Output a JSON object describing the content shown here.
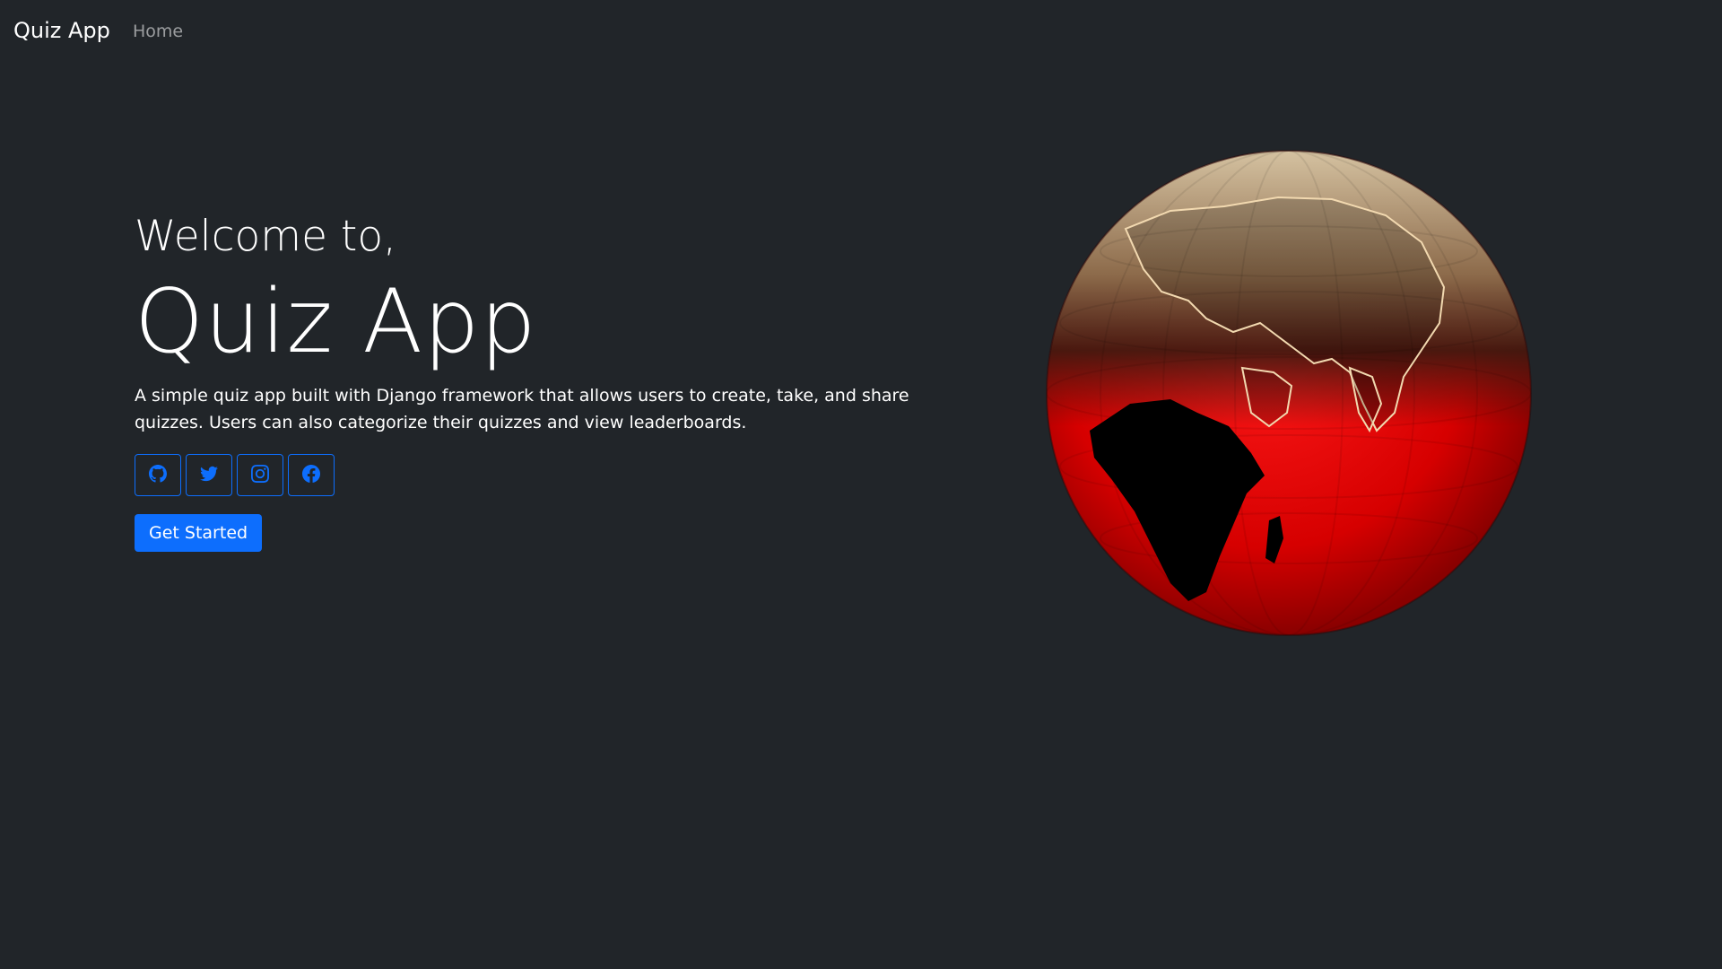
{
  "navbar": {
    "brand": "Quiz App",
    "links": [
      {
        "label": "Home"
      }
    ]
  },
  "hero": {
    "welcome": "Welcome to,",
    "title": "Quiz App",
    "description": "A simple quiz app built with Django framework that allows users to create, take, and share quizzes. Users can also categorize their quizzes and view leaderboards.",
    "social": [
      {
        "icon": "github-icon"
      },
      {
        "icon": "twitter-icon"
      },
      {
        "icon": "instagram-icon"
      },
      {
        "icon": "facebook-icon"
      }
    ],
    "cta_label": "Get Started"
  },
  "colors": {
    "background": "#212529",
    "primary": "#0d6efd",
    "globe_ocean": "#e00000",
    "globe_land": "#000000"
  }
}
